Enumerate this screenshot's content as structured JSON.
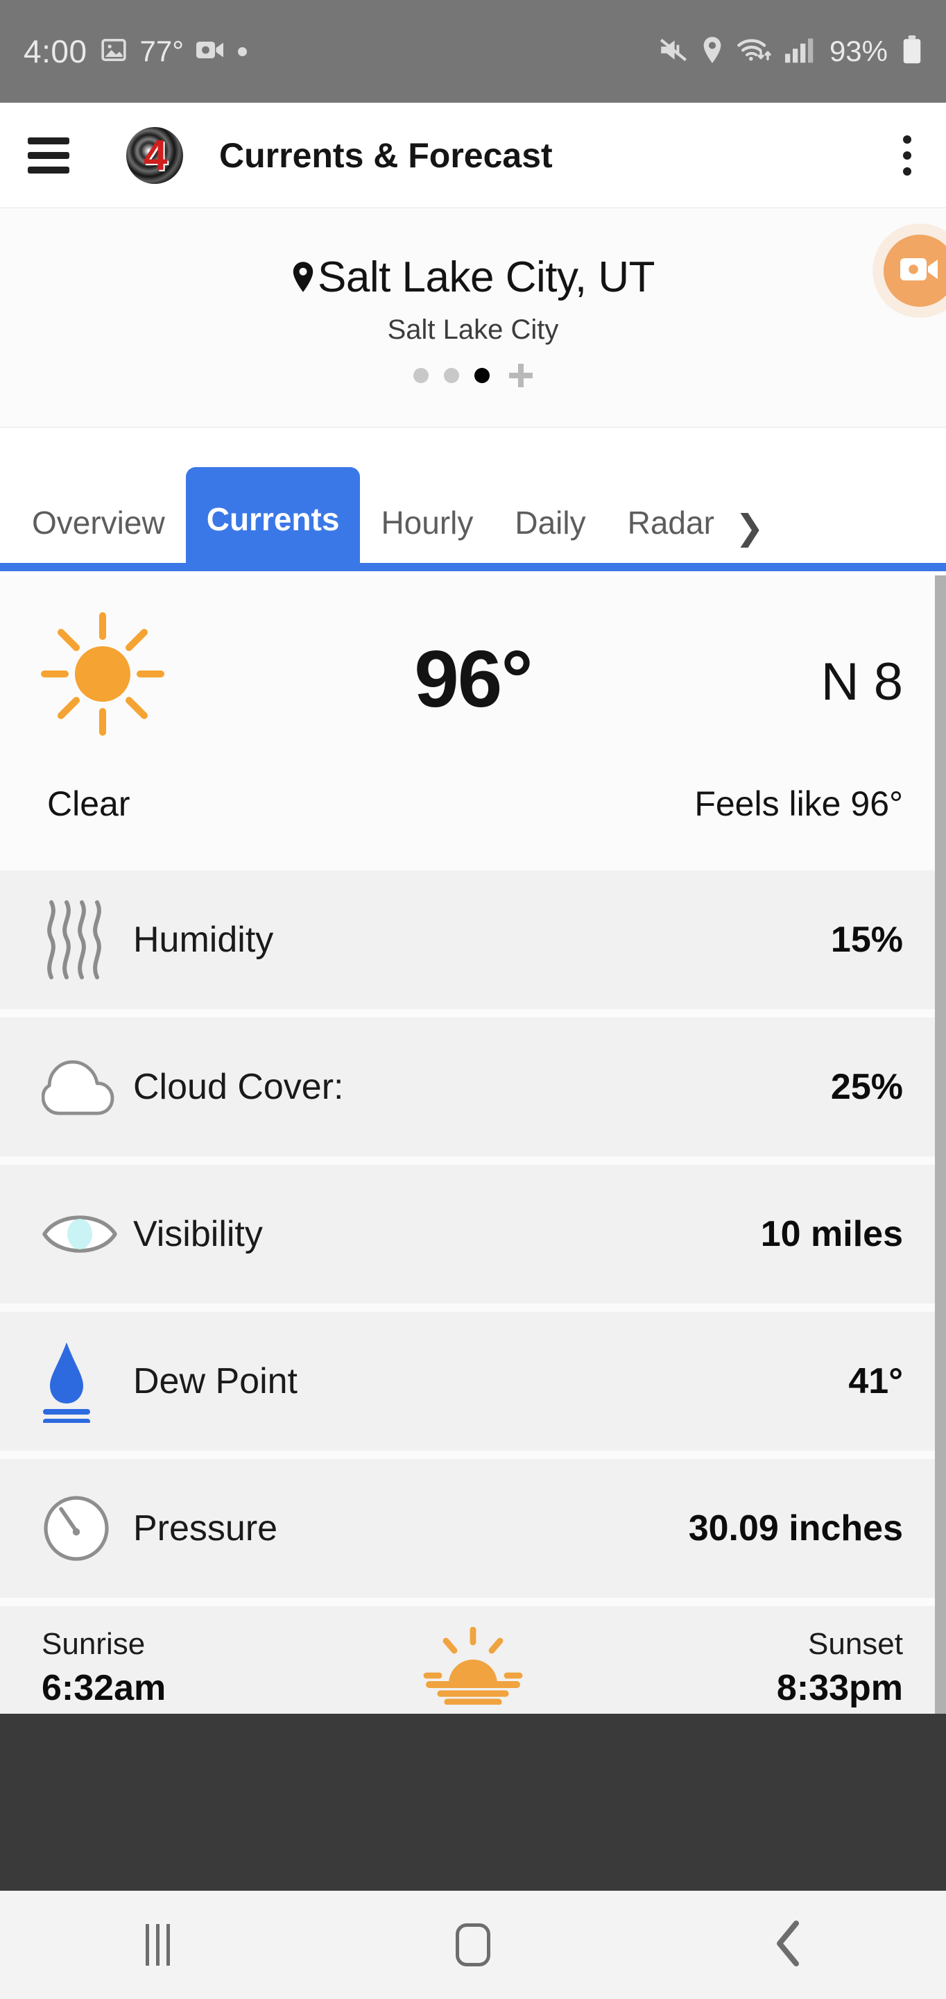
{
  "status_bar": {
    "clock": "4:00",
    "temperature": "77°",
    "battery": "93%",
    "icons": [
      "image-icon",
      "video-recording-icon",
      "record-dot-icon",
      "mute-icon",
      "location-icon",
      "wifi-icon",
      "cellular-signal-icon",
      "battery-icon"
    ]
  },
  "app_bar": {
    "menu_icon": "hamburger-menu-icon",
    "logo_text": "4",
    "title": "Currents & Forecast",
    "overflow_icon": "kebab-menu-icon"
  },
  "location": {
    "pin_icon": "location-pin-icon",
    "name": "Salt Lake City, UT",
    "subtitle": "Salt Lake City",
    "page_dots": 3,
    "active_dot_index": 2,
    "add_label": "+",
    "fab_icon": "video-camera-icon",
    "fab_color": "#f2a663"
  },
  "tabs": {
    "items": [
      {
        "label": "Overview",
        "active": false
      },
      {
        "label": "Currents",
        "active": true
      },
      {
        "label": "Hourly",
        "active": false
      },
      {
        "label": "Daily",
        "active": false
      },
      {
        "label": "Radar",
        "active": false
      }
    ],
    "more_arrow": "❯",
    "active_color": "#3b78e7"
  },
  "current": {
    "condition_icon": "sun-icon",
    "temperature": "96°",
    "wind": "N 8",
    "condition": "Clear",
    "feels_like": "Feels like 96°",
    "sun_color": "#f5a333"
  },
  "details": [
    {
      "icon": "humidity-waves-icon",
      "label": "Humidity",
      "value": "15%"
    },
    {
      "icon": "cloud-icon",
      "label": "Cloud Cover:",
      "value": "25%"
    },
    {
      "icon": "eye-visibility-icon",
      "label": "Visibility",
      "value": "10 miles"
    },
    {
      "icon": "water-drop-icon",
      "label": "Dew Point",
      "value": "41°"
    },
    {
      "icon": "pressure-gauge-icon",
      "label": "Pressure",
      "value": "30.09 inches"
    }
  ],
  "sun_times": {
    "sunrise_label": "Sunrise",
    "sunrise_value": "6:32am",
    "sunset_label": "Sunset",
    "sunset_value": "8:33pm",
    "icon": "sunrise-icon"
  },
  "nav_bar": {
    "recents_icon": "recents-icon",
    "home_icon": "home-icon",
    "back_icon": "back-icon"
  }
}
